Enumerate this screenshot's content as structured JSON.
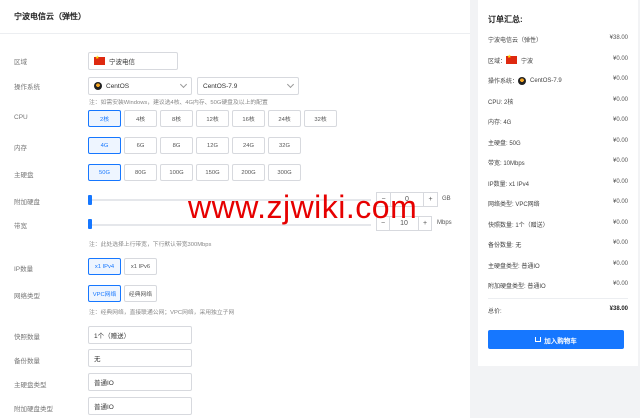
{
  "main": {
    "title": "宁波电信云（弹性）",
    "region": {
      "label": "区域",
      "value": "宁波电信"
    },
    "os": {
      "label": "操作系统",
      "distro": "CentOS",
      "version": "CentOS-7.9",
      "note": "注：如需安装Windows，建议选4核、4G内存、50G硬盘及以上的配置"
    },
    "cpu": {
      "label": "CPU",
      "options": [
        "2核",
        "4核",
        "8核",
        "12核",
        "16核",
        "24核",
        "32核"
      ],
      "selected": 0
    },
    "memory": {
      "label": "内存",
      "options": [
        "4G",
        "6G",
        "8G",
        "12G",
        "24G",
        "32G"
      ],
      "selected": 0
    },
    "disk": {
      "label": "主硬盘",
      "options": [
        "50G",
        "80G",
        "100G",
        "150G",
        "200G",
        "300G"
      ],
      "selected": 0
    },
    "extra_disk": {
      "label": "附加硬盘",
      "value": "0",
      "unit": "GB",
      "minus": "−",
      "plus": "+",
      "level": 0
    },
    "bandwidth": {
      "label": "带宽",
      "value": "10",
      "unit": "Mbps",
      "minus": "−",
      "plus": "+",
      "level": 0,
      "note": "注：此处选择上行带宽，下行默认带宽300Mbps"
    },
    "ip": {
      "label": "IP数量",
      "options": [
        "x1 IPv4",
        "x1 IPv6"
      ],
      "selected": 0
    },
    "network": {
      "label": "网络类型",
      "options": [
        "VPC网络",
        "经典网络"
      ],
      "selected": 0,
      "note": "注：经典网络，直接联通公网；VPC网络，采用独立子网"
    },
    "snapshot": {
      "label": "快照数量",
      "value": "1个（赠送）"
    },
    "backup": {
      "label": "备份数量",
      "value": "无"
    },
    "disk_type": {
      "label": "主硬盘类型",
      "value": "普通IO"
    },
    "extra_disk_type": {
      "label": "附加硬盘类型",
      "value": "普通IO"
    }
  },
  "watermark": "www.zjwiki.com",
  "summary": {
    "title": "订单汇总:",
    "rows": [
      {
        "k": "宁波电信云（弹性）",
        "v": "¥38.00"
      },
      {
        "k": "区域：",
        "flag": true,
        "k2": "宁波",
        "v": "¥0.00"
      },
      {
        "k": "操作系统：",
        "tux": true,
        "k2": "CentOS-7.9",
        "v": "¥0.00"
      },
      {
        "k": "CPU: 2核",
        "v": "¥0.00"
      },
      {
        "k": "内存: 4G",
        "v": "¥0.00"
      },
      {
        "k": "主硬盘: 50G",
        "v": "¥0.00"
      },
      {
        "k": "带宽: 10Mbps",
        "v": "¥0.00"
      },
      {
        "k": "IP数量: x1 IPv4",
        "v": "¥0.00"
      },
      {
        "k": "网络类型: VPC网络",
        "v": "¥0.00"
      },
      {
        "k": "快照数量: 1个（赠送）",
        "v": "¥0.00"
      },
      {
        "k": "备份数量: 无",
        "v": "¥0.00"
      },
      {
        "k": "主硬盘类型: 普通IO",
        "v": "¥0.00"
      },
      {
        "k": "附加硬盘类型: 普通IO",
        "v": "¥0.00"
      }
    ],
    "total_label": "总价:",
    "total_value": "¥38.00",
    "cart_label": "加入购物车"
  },
  "colors": {
    "accent": "#1677ff",
    "watermark": "#e60000",
    "flag": "#de2910"
  }
}
